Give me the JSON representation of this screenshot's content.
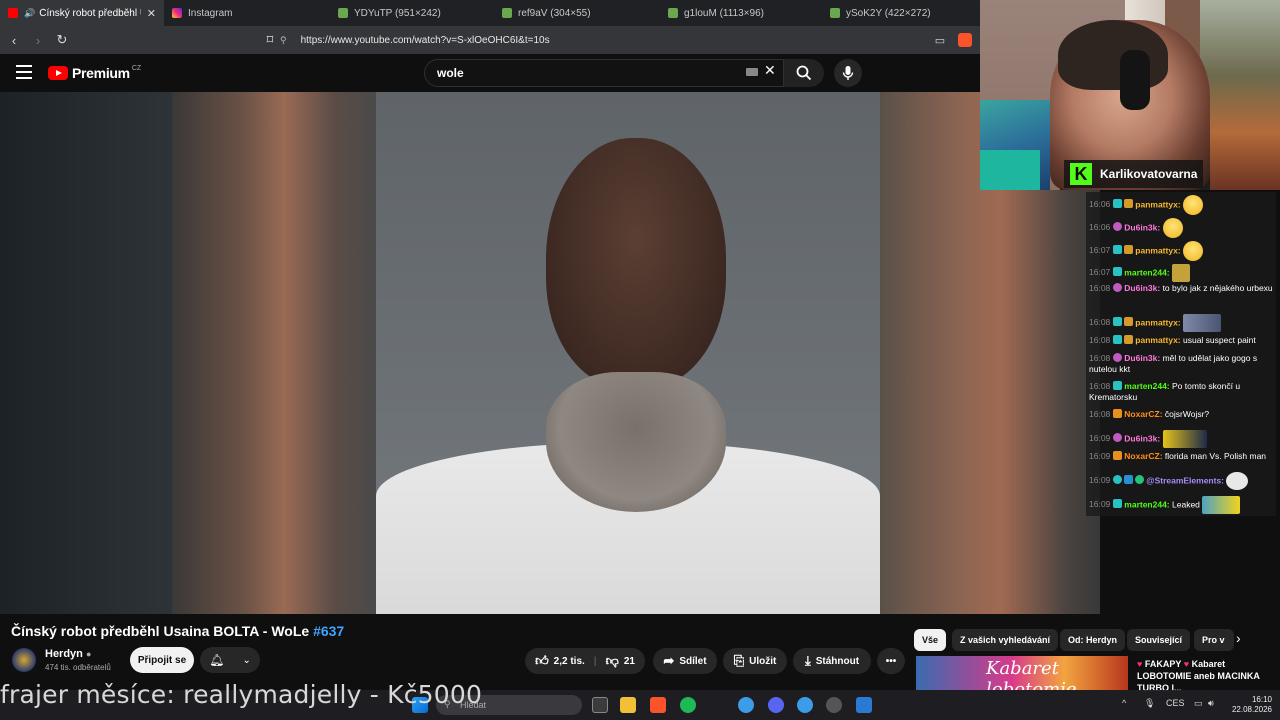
{
  "browser": {
    "tabs": [
      {
        "label": "Čínský robot předběhl Usaina",
        "active": true,
        "icon": "youtube-icon"
      },
      {
        "label": "Instagram",
        "icon": "instagram-icon"
      },
      {
        "label": "YDYuTP (951×242)",
        "icon": "image-icon"
      },
      {
        "label": "ref9aV (304×55)",
        "icon": "image-icon"
      },
      {
        "label": "g1louM (1113×96)",
        "icon": "image-icon"
      },
      {
        "label": "ySoK2Y (422×272)",
        "icon": "image-icon"
      }
    ],
    "url": "https://www.youtube.com/watch?v=S-xlOeOHC6I&t=10s"
  },
  "youtube": {
    "logo_text": "Premium",
    "logo_region": "CZ",
    "search_query": "wole"
  },
  "video": {
    "title": "Čínský robot předběhl Usaina BOLTA - WoLe ",
    "title_tag": "#637",
    "channel": "Herdyn",
    "subscribers": "474 tis. odběratelů",
    "join_label": "Připojit se",
    "likes": "2,2 tis.",
    "dislikes": "21",
    "share_label": "Sdílet",
    "save_label": "Uložit",
    "download_label": "Stáhnout",
    "more_label": "•••"
  },
  "chips": [
    "Vše",
    "Z vašich vyhledávání",
    "Od: Herdyn",
    "Související",
    "Pro v"
  ],
  "recommended": {
    "thumb_text": "Kabaret lobotomie",
    "title_line1": "FAKAPY",
    "title_line1b": "Kabaret",
    "title_line2": "LOBOTOMIE aneb MACINKA",
    "title_line3": "TURBO I..."
  },
  "webcam": {
    "streamer": "Karlikovatovarna"
  },
  "chat": [
    {
      "time": "16:06",
      "user": "panmattyx:",
      "text": "",
      "emote": "sad-face",
      "color": "#f5b82e"
    },
    {
      "time": "16:06",
      "user": "Du6in3k:",
      "text": "",
      "emote": "sad-face",
      "color": "#ff7ad9"
    },
    {
      "time": "16:07",
      "user": "panmattyx:",
      "text": "",
      "emote": "sad-face",
      "color": "#f5b82e"
    },
    {
      "time": "16:07",
      "user": "marten244:",
      "text": "",
      "emote": "img",
      "color": "#53fc18"
    },
    {
      "time": "16:08",
      "user": "Du6in3k:",
      "text": "to bylo jak z nějakého urbexu",
      "color": "#ff7ad9"
    },
    {
      "time": "16:08",
      "user": "panmattyx:",
      "text": "",
      "emote": "img",
      "color": "#f5b82e"
    },
    {
      "time": "16:08",
      "user": "panmattyx:",
      "text": "usual suspect paint",
      "color": "#f5b82e"
    },
    {
      "time": "16:08",
      "user": "Du6in3k:",
      "text": "měl to udělat jako gogo s nutelou kkt",
      "color": "#ff7ad9"
    },
    {
      "time": "16:08",
      "user": "marten244:",
      "text": "Po tomto skončí u Krematorsku",
      "color": "#53fc18"
    },
    {
      "time": "16:08",
      "user": "NoxarCZ:",
      "text": "čojsrWojsr?",
      "color": "#ff8c1a"
    },
    {
      "time": "16:09",
      "user": "Du6in3k:",
      "text": "",
      "emote": "img",
      "color": "#ff7ad9"
    },
    {
      "time": "16:09",
      "user": "NoxarCZ:",
      "text": "florida man Vs. Polish man",
      "color": "#ff8c1a"
    },
    {
      "time": "16:09",
      "user": "@StreamElements:",
      "text": "",
      "emote": "img",
      "color": "#a78bfa"
    },
    {
      "time": "16:09",
      "user": "marten244:",
      "text": "Leaked",
      "emote": "img",
      "color": "#53fc18"
    }
  ],
  "ticker": "frajer měsíce: reallymadjelly - Kč5000",
  "taskbar": {
    "search_placeholder": "Hledat",
    "lang": "CES",
    "time": "16:10",
    "date": "22.08.2026"
  },
  "colors": {
    "accent_blue": "#3ea6ff",
    "youtube_red": "#ff0000",
    "kick_green": "#53fc18"
  }
}
